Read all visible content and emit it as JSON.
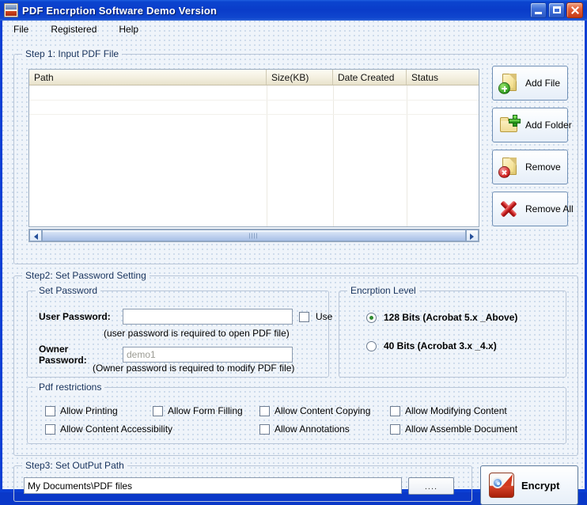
{
  "window": {
    "title": "PDF Encrption Software Demo Version",
    "app_icon": "pdf-app-icon",
    "controls": {
      "minimize": "minimize-icon",
      "maximize": "maximize-icon",
      "close": "close-icon"
    }
  },
  "menu": {
    "items": [
      "File",
      "Registered",
      "Help"
    ]
  },
  "step1": {
    "legend": "Step 1: Input PDF File",
    "columns": [
      "Path",
      "Size(KB)",
      "Date Created",
      "Status"
    ],
    "rows": [],
    "scrollbar": {
      "left_arrow": "chevron-left-icon",
      "right_arrow": "chevron-right-icon"
    },
    "buttons": [
      {
        "label": "Add File",
        "icon": "file-add-icon"
      },
      {
        "label": "Add Folder",
        "icon": "folder-add-icon"
      },
      {
        "label": "Remove",
        "icon": "file-remove-icon"
      },
      {
        "label": "Remove All",
        "icon": "remove-all-icon"
      }
    ]
  },
  "step2": {
    "legend": "Step2: Set Password Setting",
    "set_password": {
      "legend": "Set Password",
      "user_password_label": "User Password:",
      "user_password_value": "",
      "use_checkbox_label": "Use",
      "use_checked": false,
      "user_hint": "(user password is required to open PDF file)",
      "owner_password_label": "Owner Password:",
      "owner_password_value": "demo1",
      "owner_hint": "(Owner password is required to modify PDF file)"
    },
    "encryption_level": {
      "legend": "Encrption Level",
      "options": [
        {
          "label": "128 Bits (Acrobat 5.x _Above)",
          "selected": true
        },
        {
          "label": "40 Bits (Acrobat 3.x _4.x)",
          "selected": false
        }
      ],
      "selected_color": "#2f8b2f"
    },
    "pdf_restrictions": {
      "legend": "Pdf restrictions",
      "items": [
        {
          "label": "Allow Printing",
          "checked": false
        },
        {
          "label": "Allow Form Filling",
          "checked": false
        },
        {
          "label": "Allow Content Copying",
          "checked": false
        },
        {
          "label": "Allow Modifying Content",
          "checked": false
        },
        {
          "label": "Allow Content Accessibility",
          "checked": false
        },
        {
          "label": "Allow Annotations",
          "checked": false
        },
        {
          "label": "Allow Assemble Document",
          "checked": false
        }
      ]
    }
  },
  "step3": {
    "legend": "Step3: Set OutPut Path",
    "path_value": "My Documents\\PDF files",
    "browse_label": "....",
    "encrypt_label": "Encrypt",
    "encrypt_icon": "pdf-encrypt-icon"
  },
  "colors": {
    "titlebar": "#0a3cc9",
    "window_border": "#0b3fd4",
    "client_bg": "#eff4fa",
    "group_border": "#b9c6d8",
    "legend_text": "#17325c",
    "list_header": "#f3efdf"
  }
}
